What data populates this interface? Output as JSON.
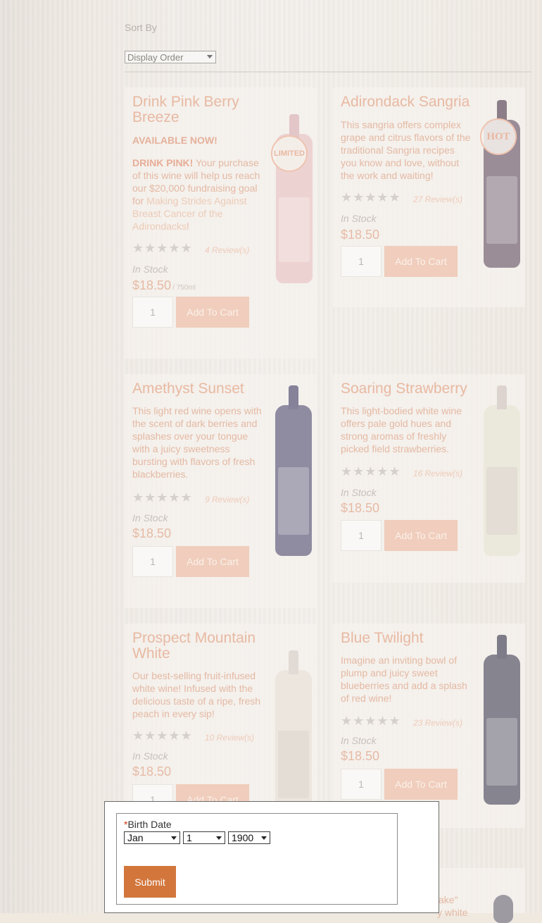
{
  "sort": {
    "label": "Sort By",
    "selected": "Display Order"
  },
  "products": [
    {
      "name": "Drink Pink Berry Breeze",
      "availability": "AVAILABLE NOW!",
      "desc_bold": "DRINK PINK!",
      "desc_text": "Your purchase of this wine will help us reach our $20,000 fundraising goal for",
      "desc_link": "Making Strides Against Breast Cancer of the Adirondacks",
      "desc_end": "!",
      "stars": "★★★★★",
      "reviews": "4 Review(s)",
      "stock": "In Stock",
      "price": "$18.50",
      "unit": "/ 750ml",
      "qty": "1",
      "cart": "Add To Cart",
      "badge": "LIMITED",
      "bottle_color": "#e8c7c7"
    },
    {
      "name": "Adirondack Sangria",
      "desc": "This sangria offers complex grape and citrus flavors of the traditional Sangria recipes you know and love, without the work and waiting!",
      "stars": "★★★★★",
      "reviews": "27 Review(s)",
      "stock": "In Stock",
      "price": "$18.50",
      "qty": "1",
      "cart": "Add To Cart",
      "badge": "HOT",
      "bottle_color": "#8f7f8a"
    },
    {
      "name": "Amethyst Sunset",
      "desc": "This light red wine opens with the scent of dark berries and splashes over your tongue with a juicy sweetness bursting with flavors of fresh blackberries.",
      "stars": "★★★★★",
      "reviews": "9 Review(s)",
      "stock": "In Stock",
      "price": "$18.50",
      "qty": "1",
      "cart": "Add To Cart",
      "bottle_color": "#8a869b"
    },
    {
      "name": "Soaring Strawberry",
      "desc": "This light-bodied white wine offers pale gold hues and strong aromas of freshly picked field strawberries.",
      "stars": "★★★★★",
      "reviews": "16 Review(s)",
      "stock": "In Stock",
      "price": "$18.50",
      "qty": "1",
      "cart": "Add To Cart",
      "bottle_color": "#e7e5d9"
    },
    {
      "name": "Prospect Mountain White",
      "desc": "Our best-selling fruit-infused white wine! Infused with the delicious taste of a ripe, fresh peach in every sip!",
      "stars": "★★★★★",
      "reviews": "10 Review(s)",
      "stock": "In Stock",
      "price": "$18.50",
      "qty": "1",
      "cart": "Add To Cart",
      "bottle_color": "#ebe5de"
    },
    {
      "name": "Blue Twilight",
      "desc": "Imagine an inviting bowl of plump and juicy sweet blueberries and add a splash of red wine!",
      "stars": "★★★★★",
      "reviews": "23 Review(s)",
      "stock": "In Stock",
      "price": "$18.50",
      "qty": "1",
      "cart": "Add To Cart",
      "bottle_color": "#7f7e8c"
    }
  ],
  "partial": {
    "text1": "ake\"",
    "text2": "y white"
  },
  "age_gate": {
    "required_mark": "*",
    "label": "Birth Date",
    "month": "Jan",
    "day": "1",
    "year": "1900",
    "submit": "Submit"
  },
  "colors": {
    "accent": "#d2763c",
    "title": "#e8b9a2",
    "button_faded": "#f0cdbc"
  }
}
